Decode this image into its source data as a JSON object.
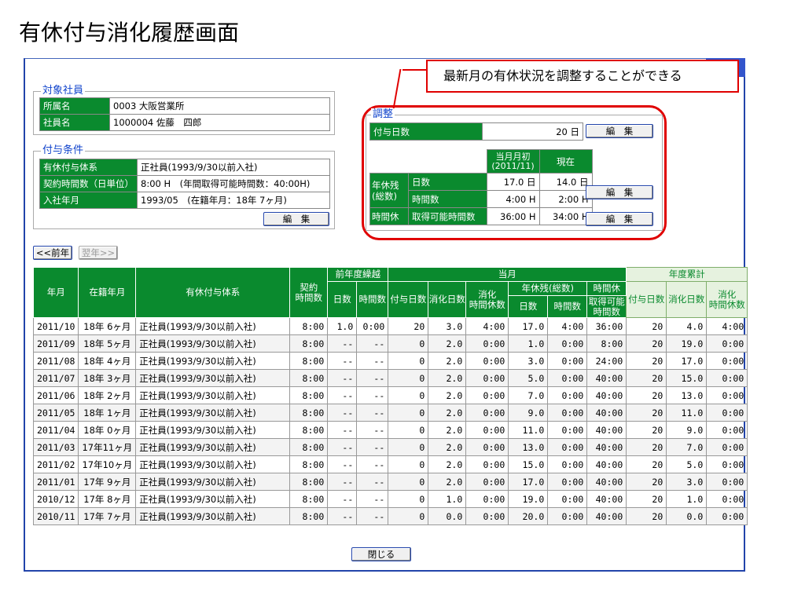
{
  "page_title": "有休付与消化履歴画面",
  "callout": "最新月の有休状況を調整することができる",
  "employee": {
    "section": "対象社員",
    "office_label": "所属名",
    "office_value": "0003 大阪営業所",
    "name_label": "社員名",
    "name_value": "1000004 佐藤　四郎"
  },
  "conditions": {
    "section": "付与条件",
    "system_label": "有休付与体系",
    "system_value": "正社員(1993/9/30以前入社)",
    "hours_label": "契約時間数（日単位）",
    "hours_value": "8:00 H　(年間取得可能時間数：40:00H)",
    "join_label": "入社年月",
    "join_value": "1993/05　(在籍年月：18年 7ヶ月)",
    "edit": "編　集"
  },
  "adjust": {
    "section": "調整",
    "grant_label": "付与日数",
    "grant_value": "20 日",
    "edit": "編　集",
    "col_initial": "当月月初\n(2011/11)",
    "col_current": "現在",
    "remain_label": "年休残\n(総数)",
    "days_label": "日数",
    "days_initial": "17.0 日",
    "days_current": "14.0 日",
    "hours_label": "時間数",
    "hours_initial": "4:00 H",
    "hours_current": "2:00 H",
    "hourly_label": "時間休",
    "hourly_sub": "取得可能時間数",
    "hourly_initial": "36:00 H",
    "hourly_current": "34:00 H"
  },
  "nav": {
    "prev": "<<前年",
    "next": "翌年>>"
  },
  "close": "閉じる",
  "table": {
    "h_month": "年月",
    "h_tenure": "在籍年月",
    "h_system": "有休付与体系",
    "h_contract": "契約\n時間数",
    "h_carry": "前年度繰越",
    "h_carry_days": "日数",
    "h_carry_hours": "時間数",
    "h_current": "当月",
    "h_grant": "付与日数",
    "h_used": "消化日数",
    "h_used_hours": "消化\n時間休数",
    "h_remain": "年休残(総数)",
    "h_remain_days": "日数",
    "h_remain_hours": "時間数",
    "h_hourly": "時間休",
    "h_hourly_sub": "取得可能\n時間数",
    "h_cum": "年度累計",
    "h_cum_grant": "付与日数",
    "h_cum_used": "消化日数",
    "h_cum_hours": "消化\n時間休数",
    "rows": [
      [
        "2011/10",
        "18年 6ヶ月",
        "正社員(1993/9/30以前入社)",
        "8:00",
        "1.0",
        "0:00",
        "20",
        "3.0",
        "4:00",
        "17.0",
        "4:00",
        "36:00",
        "20",
        "4.0",
        "4:00"
      ],
      [
        "2011/09",
        "18年 5ヶ月",
        "正社員(1993/9/30以前入社)",
        "8:00",
        "--",
        "--",
        "0",
        "2.0",
        "0:00",
        "1.0",
        "0:00",
        "8:00",
        "20",
        "19.0",
        "0:00"
      ],
      [
        "2011/08",
        "18年 4ヶ月",
        "正社員(1993/9/30以前入社)",
        "8:00",
        "--",
        "--",
        "0",
        "2.0",
        "0:00",
        "3.0",
        "0:00",
        "24:00",
        "20",
        "17.0",
        "0:00"
      ],
      [
        "2011/07",
        "18年 3ヶ月",
        "正社員(1993/9/30以前入社)",
        "8:00",
        "--",
        "--",
        "0",
        "2.0",
        "0:00",
        "5.0",
        "0:00",
        "40:00",
        "20",
        "15.0",
        "0:00"
      ],
      [
        "2011/06",
        "18年 2ヶ月",
        "正社員(1993/9/30以前入社)",
        "8:00",
        "--",
        "--",
        "0",
        "2.0",
        "0:00",
        "7.0",
        "0:00",
        "40:00",
        "20",
        "13.0",
        "0:00"
      ],
      [
        "2011/05",
        "18年 1ヶ月",
        "正社員(1993/9/30以前入社)",
        "8:00",
        "--",
        "--",
        "0",
        "2.0",
        "0:00",
        "9.0",
        "0:00",
        "40:00",
        "20",
        "11.0",
        "0:00"
      ],
      [
        "2011/04",
        "18年 0ヶ月",
        "正社員(1993/9/30以前入社)",
        "8:00",
        "--",
        "--",
        "0",
        "2.0",
        "0:00",
        "11.0",
        "0:00",
        "40:00",
        "20",
        "9.0",
        "0:00"
      ],
      [
        "2011/03",
        "17年11ヶ月",
        "正社員(1993/9/30以前入社)",
        "8:00",
        "--",
        "--",
        "0",
        "2.0",
        "0:00",
        "13.0",
        "0:00",
        "40:00",
        "20",
        "7.0",
        "0:00"
      ],
      [
        "2011/02",
        "17年10ヶ月",
        "正社員(1993/9/30以前入社)",
        "8:00",
        "--",
        "--",
        "0",
        "2.0",
        "0:00",
        "15.0",
        "0:00",
        "40:00",
        "20",
        "5.0",
        "0:00"
      ],
      [
        "2011/01",
        "17年 9ヶ月",
        "正社員(1993/9/30以前入社)",
        "8:00",
        "--",
        "--",
        "0",
        "2.0",
        "0:00",
        "17.0",
        "0:00",
        "40:00",
        "20",
        "3.0",
        "0:00"
      ],
      [
        "2010/12",
        "17年 8ヶ月",
        "正社員(1993/9/30以前入社)",
        "8:00",
        "--",
        "--",
        "0",
        "1.0",
        "0:00",
        "19.0",
        "0:00",
        "40:00",
        "20",
        "1.0",
        "0:00"
      ],
      [
        "2010/11",
        "17年 7ヶ月",
        "正社員(1993/9/30以前入社)",
        "8:00",
        "--",
        "--",
        "0",
        "0.0",
        "0:00",
        "20.0",
        "0:00",
        "40:00",
        "20",
        "0.0",
        "0:00"
      ]
    ]
  }
}
